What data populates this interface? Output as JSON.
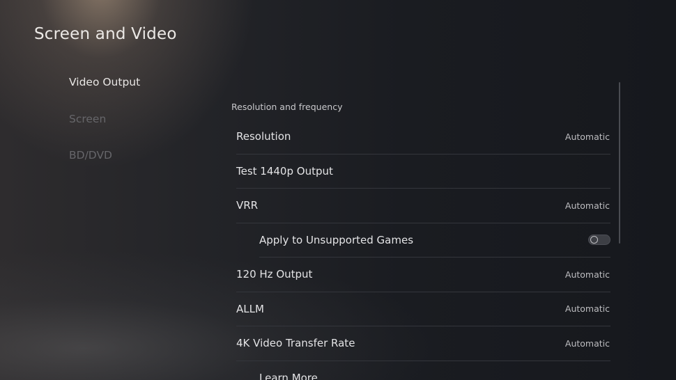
{
  "header": {
    "title": "Screen and Video"
  },
  "nav": {
    "items": [
      {
        "label": "Video Output",
        "active": true
      },
      {
        "label": "Screen",
        "active": false
      },
      {
        "label": "BD/DVD",
        "active": false
      }
    ]
  },
  "content": {
    "section_label": "Resolution and frequency",
    "rows": [
      {
        "label": "Resolution",
        "value": "Automatic"
      },
      {
        "label": "Test 1440p Output",
        "value": ""
      },
      {
        "label": "VRR",
        "value": "Automatic"
      },
      {
        "label": "Apply to Unsupported Games",
        "toggle": "off"
      },
      {
        "label": "120 Hz Output",
        "value": "Automatic"
      },
      {
        "label": "ALLM",
        "value": "Automatic"
      },
      {
        "label": "4K Video Transfer Rate",
        "value": "Automatic"
      },
      {
        "label": "Learn More",
        "value": ""
      }
    ]
  }
}
